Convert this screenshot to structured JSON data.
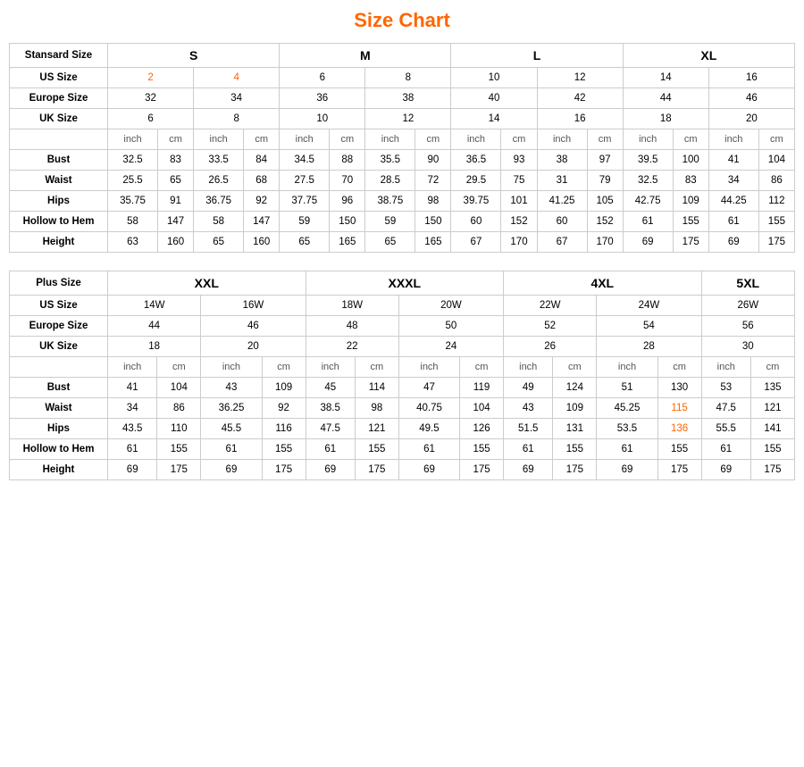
{
  "title": "Size Chart",
  "standard": {
    "table_title": "Stansard Size",
    "sizes": [
      "S",
      "M",
      "L",
      "XL"
    ],
    "us_label": "US Size",
    "us_sizes": [
      "2",
      "4",
      "6",
      "8",
      "10",
      "12",
      "14",
      "16"
    ],
    "europe_label": "Europe Size",
    "europe_sizes": [
      "32",
      "34",
      "36",
      "38",
      "40",
      "42",
      "44",
      "46"
    ],
    "uk_label": "UK Size",
    "uk_sizes": [
      "6",
      "8",
      "10",
      "12",
      "14",
      "16",
      "18",
      "20"
    ],
    "measurements": [
      {
        "name": "Bust",
        "values": [
          "32.5",
          "83",
          "33.5",
          "84",
          "34.5",
          "88",
          "35.5",
          "90",
          "36.5",
          "93",
          "38",
          "97",
          "39.5",
          "100",
          "41",
          "104"
        ]
      },
      {
        "name": "Waist",
        "values": [
          "25.5",
          "65",
          "26.5",
          "68",
          "27.5",
          "70",
          "28.5",
          "72",
          "29.5",
          "75",
          "31",
          "79",
          "32.5",
          "83",
          "34",
          "86"
        ]
      },
      {
        "name": "Hips",
        "values": [
          "35.75",
          "91",
          "36.75",
          "92",
          "37.75",
          "96",
          "38.75",
          "98",
          "39.75",
          "101",
          "41.25",
          "105",
          "42.75",
          "109",
          "44.25",
          "112"
        ]
      },
      {
        "name": "Hollow to Hem",
        "values": [
          "58",
          "147",
          "58",
          "147",
          "59",
          "150",
          "59",
          "150",
          "60",
          "152",
          "60",
          "152",
          "61",
          "155",
          "61",
          "155"
        ]
      },
      {
        "name": "Height",
        "values": [
          "63",
          "160",
          "65",
          "160",
          "65",
          "165",
          "65",
          "165",
          "67",
          "170",
          "67",
          "170",
          "69",
          "175",
          "69",
          "175"
        ]
      }
    ]
  },
  "plus": {
    "table_title": "Plus Size",
    "sizes": [
      "XXL",
      "XXXL",
      "4XL",
      "5XL"
    ],
    "us_label": "US Size",
    "us_sizes": [
      "14W",
      "16W",
      "18W",
      "20W",
      "22W",
      "24W",
      "26W"
    ],
    "europe_label": "Europe Size",
    "europe_sizes": [
      "44",
      "46",
      "48",
      "50",
      "52",
      "54",
      "56"
    ],
    "uk_label": "UK Size",
    "uk_sizes": [
      "18",
      "20",
      "22",
      "24",
      "26",
      "28",
      "30"
    ],
    "measurements": [
      {
        "name": "Bust",
        "values": [
          "41",
          "104",
          "43",
          "109",
          "45",
          "114",
          "47",
          "119",
          "49",
          "124",
          "51",
          "130",
          "53",
          "135"
        ]
      },
      {
        "name": "Waist",
        "values": [
          "34",
          "86",
          "36.25",
          "92",
          "38.5",
          "98",
          "40.75",
          "104",
          "43",
          "109",
          "45.25",
          "115",
          "47.5",
          "121"
        ]
      },
      {
        "name": "Hips",
        "values": [
          "43.5",
          "110",
          "45.5",
          "116",
          "47.5",
          "121",
          "49.5",
          "126",
          "51.5",
          "131",
          "53.5",
          "136",
          "55.5",
          "141"
        ]
      },
      {
        "name": "Hollow to Hem",
        "values": [
          "61",
          "155",
          "61",
          "155",
          "61",
          "155",
          "61",
          "155",
          "61",
          "155",
          "61",
          "155",
          "61",
          "155"
        ]
      },
      {
        "name": "Height",
        "values": [
          "69",
          "175",
          "69",
          "175",
          "69",
          "175",
          "69",
          "175",
          "69",
          "175",
          "69",
          "175",
          "69",
          "175"
        ]
      }
    ]
  }
}
